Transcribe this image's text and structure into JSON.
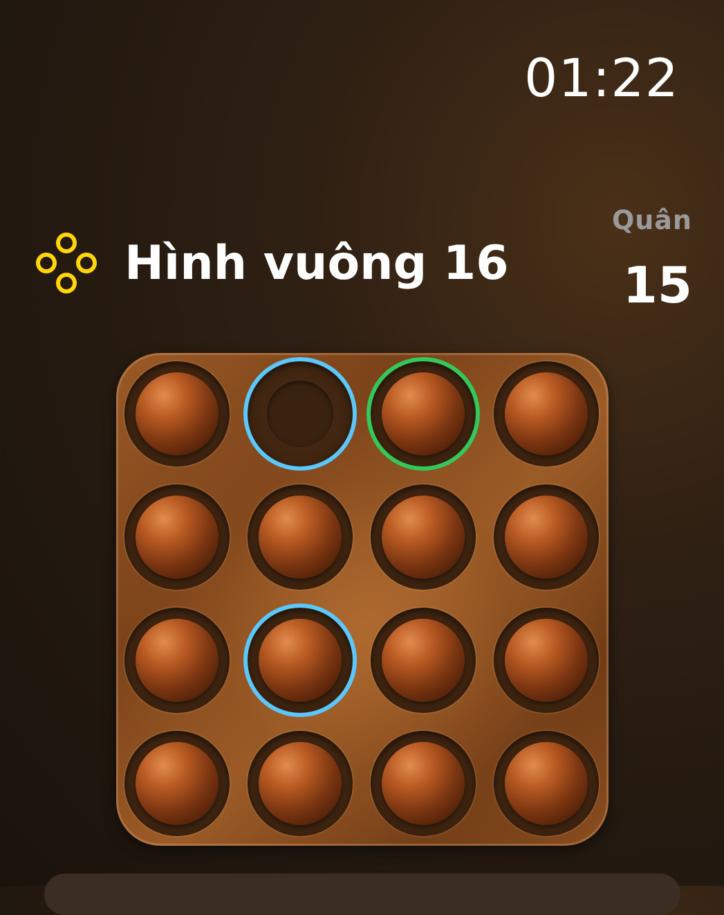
{
  "status": {
    "time": "01:22"
  },
  "level": {
    "icon": "four-circles-icon",
    "title": "Hình vuông 16"
  },
  "pieces": {
    "label": "Quân",
    "count": "15"
  },
  "colors": {
    "icon_yellow": "#ffd60a",
    "selection_blue": "#5ac8fa",
    "target_green": "#34c759",
    "board_wood": "#8a4e20",
    "marble": "#b85a22"
  },
  "board": {
    "rows": 4,
    "cols": 4,
    "cells": [
      {
        "marble": true,
        "highlight": "none"
      },
      {
        "marble": false,
        "highlight": "blue"
      },
      {
        "marble": true,
        "highlight": "green"
      },
      {
        "marble": true,
        "highlight": "none"
      },
      {
        "marble": true,
        "highlight": "none"
      },
      {
        "marble": true,
        "highlight": "none"
      },
      {
        "marble": true,
        "highlight": "none"
      },
      {
        "marble": true,
        "highlight": "none"
      },
      {
        "marble": true,
        "highlight": "none"
      },
      {
        "marble": true,
        "highlight": "blue"
      },
      {
        "marble": true,
        "highlight": "none"
      },
      {
        "marble": true,
        "highlight": "none"
      },
      {
        "marble": true,
        "highlight": "none"
      },
      {
        "marble": true,
        "highlight": "none"
      },
      {
        "marble": true,
        "highlight": "none"
      },
      {
        "marble": true,
        "highlight": "none"
      }
    ]
  }
}
